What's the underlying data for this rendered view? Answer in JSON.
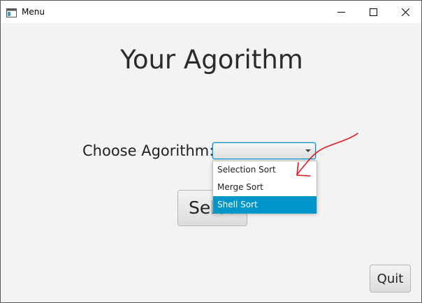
{
  "window": {
    "title": "Menu",
    "icon": "app-window-icon",
    "controls": [
      "minimize-icon",
      "maximize-icon",
      "close-icon"
    ]
  },
  "main": {
    "heading": "Your Agorithm",
    "choose_label": "Choose Agorithm:",
    "combo": {
      "value": "",
      "options": [
        {
          "label": "Selection Sort",
          "selected": false
        },
        {
          "label": "Merge Sort",
          "selected": false
        },
        {
          "label": "Shell Sort",
          "selected": true
        }
      ]
    },
    "select_button": "Select",
    "quit_button": "Quit"
  },
  "colors": {
    "accent": "#0096c9",
    "annotation": "#e0181b",
    "window_bg": "#f3f3f3"
  }
}
